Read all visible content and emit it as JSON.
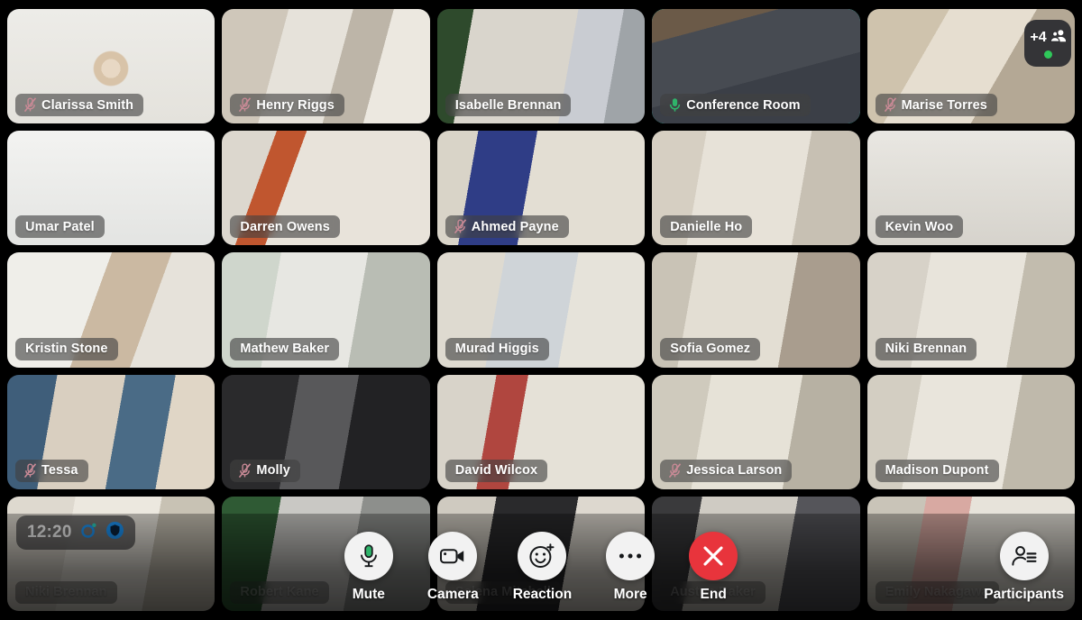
{
  "meeting": {
    "timer": "12:20",
    "overflow_count": "+4",
    "accent_active_border": "#2dd4bf",
    "mic_muted_color": "#c98a96",
    "mic_active_color": "#2fb36a",
    "presence_dot_color": "#2fc85a",
    "end_button_color": "#e8343c",
    "recording_icon_color": "#1e9bff",
    "shield_icon_color": "#1e9bff"
  },
  "icons": {
    "mic_muted": "mic-muted-icon",
    "mic_active": "mic-active-icon",
    "people": "people-icon",
    "recording": "recording-indicator-icon",
    "shield": "shield-icon",
    "camera": "camera-icon",
    "reaction": "reaction-smiley-icon",
    "more": "more-dots-icon",
    "end_call": "end-call-x-icon",
    "participants": "participants-list-icon"
  },
  "participants": [
    {
      "name": "Clarissa Smith",
      "muted": true,
      "active": false,
      "row": 1,
      "col": 1,
      "bg": "clarissa"
    },
    {
      "name": "Henry Riggs",
      "muted": true,
      "active": false,
      "row": 1,
      "col": 2,
      "bg": "henry"
    },
    {
      "name": "Isabelle Brennan",
      "muted": false,
      "active": false,
      "row": 1,
      "col": 3,
      "bg": "isabelle"
    },
    {
      "name": "Conference Room",
      "muted": false,
      "active": true,
      "speaking": true,
      "row": 1,
      "col": 4,
      "bg": "conference"
    },
    {
      "name": "Marise Torres",
      "muted": true,
      "active": false,
      "row": 1,
      "col": 5,
      "bg": "marise"
    },
    {
      "name": "Umar Patel",
      "muted": false,
      "active": false,
      "row": 2,
      "col": 1,
      "bg": "umar"
    },
    {
      "name": "Darren Owens",
      "muted": false,
      "active": false,
      "row": 2,
      "col": 2,
      "bg": "darren"
    },
    {
      "name": "Ahmed Payne",
      "muted": true,
      "active": false,
      "row": 2,
      "col": 3,
      "bg": "ahmed"
    },
    {
      "name": "Danielle Ho",
      "muted": false,
      "active": false,
      "row": 2,
      "col": 4,
      "bg": "danielle"
    },
    {
      "name": "Kevin Woo",
      "muted": false,
      "active": false,
      "row": 2,
      "col": 5,
      "bg": "kevin"
    },
    {
      "name": "Kristin Stone",
      "muted": false,
      "active": false,
      "row": 3,
      "col": 1,
      "bg": "kristin"
    },
    {
      "name": "Mathew Baker",
      "muted": false,
      "active": false,
      "row": 3,
      "col": 2,
      "bg": "mathew"
    },
    {
      "name": "Murad Higgis",
      "muted": false,
      "active": false,
      "row": 3,
      "col": 3,
      "bg": "murad"
    },
    {
      "name": "Sofia Gomez",
      "muted": false,
      "active": false,
      "row": 3,
      "col": 4,
      "bg": "sofia"
    },
    {
      "name": "Niki Brennan",
      "muted": false,
      "active": false,
      "row": 3,
      "col": 5,
      "bg": "niki3"
    },
    {
      "name": "Tessa",
      "muted": true,
      "active": false,
      "row": 4,
      "col": 1,
      "bg": "tessa"
    },
    {
      "name": "Molly",
      "muted": true,
      "active": false,
      "row": 4,
      "col": 2,
      "bg": "molly"
    },
    {
      "name": "David  Wilcox",
      "muted": false,
      "active": false,
      "row": 4,
      "col": 3,
      "bg": "david"
    },
    {
      "name": "Jessica Larson",
      "muted": true,
      "active": false,
      "row": 4,
      "col": 4,
      "bg": "jessica"
    },
    {
      "name": "Madison Dupont",
      "muted": false,
      "active": false,
      "row": 4,
      "col": 5,
      "bg": "madison"
    },
    {
      "name": "Niki Brennan",
      "muted": false,
      "active": false,
      "row": 5,
      "col": 1,
      "bg": "niki5",
      "dim": true
    },
    {
      "name": "Robert Kane",
      "muted": false,
      "active": false,
      "row": 5,
      "col": 2,
      "bg": "robert",
      "dim": true
    },
    {
      "name": "Selena Mitchell",
      "muted": false,
      "active": false,
      "row": 5,
      "col": 3,
      "bg": "selena",
      "dim": true
    },
    {
      "name": "Austen Baker",
      "muted": false,
      "active": false,
      "row": 5,
      "col": 4,
      "bg": "austen",
      "dim": true
    },
    {
      "name": "Emily Nakagawa",
      "muted": false,
      "active": false,
      "row": 5,
      "col": 5,
      "bg": "emily",
      "dim": true
    }
  ],
  "controls": [
    {
      "id": "mute",
      "label": "Mute",
      "icon": "mic-active-icon",
      "style": "light"
    },
    {
      "id": "camera",
      "label": "Camera",
      "icon": "camera-icon",
      "style": "light"
    },
    {
      "id": "reaction",
      "label": "Reaction",
      "icon": "reaction-smiley-icon",
      "style": "light"
    },
    {
      "id": "more",
      "label": "More",
      "icon": "more-dots-icon",
      "style": "light"
    },
    {
      "id": "end",
      "label": "End",
      "icon": "end-call-x-icon",
      "style": "danger"
    },
    {
      "id": "participants",
      "label": "Participants",
      "icon": "participants-list-icon",
      "style": "light"
    }
  ]
}
